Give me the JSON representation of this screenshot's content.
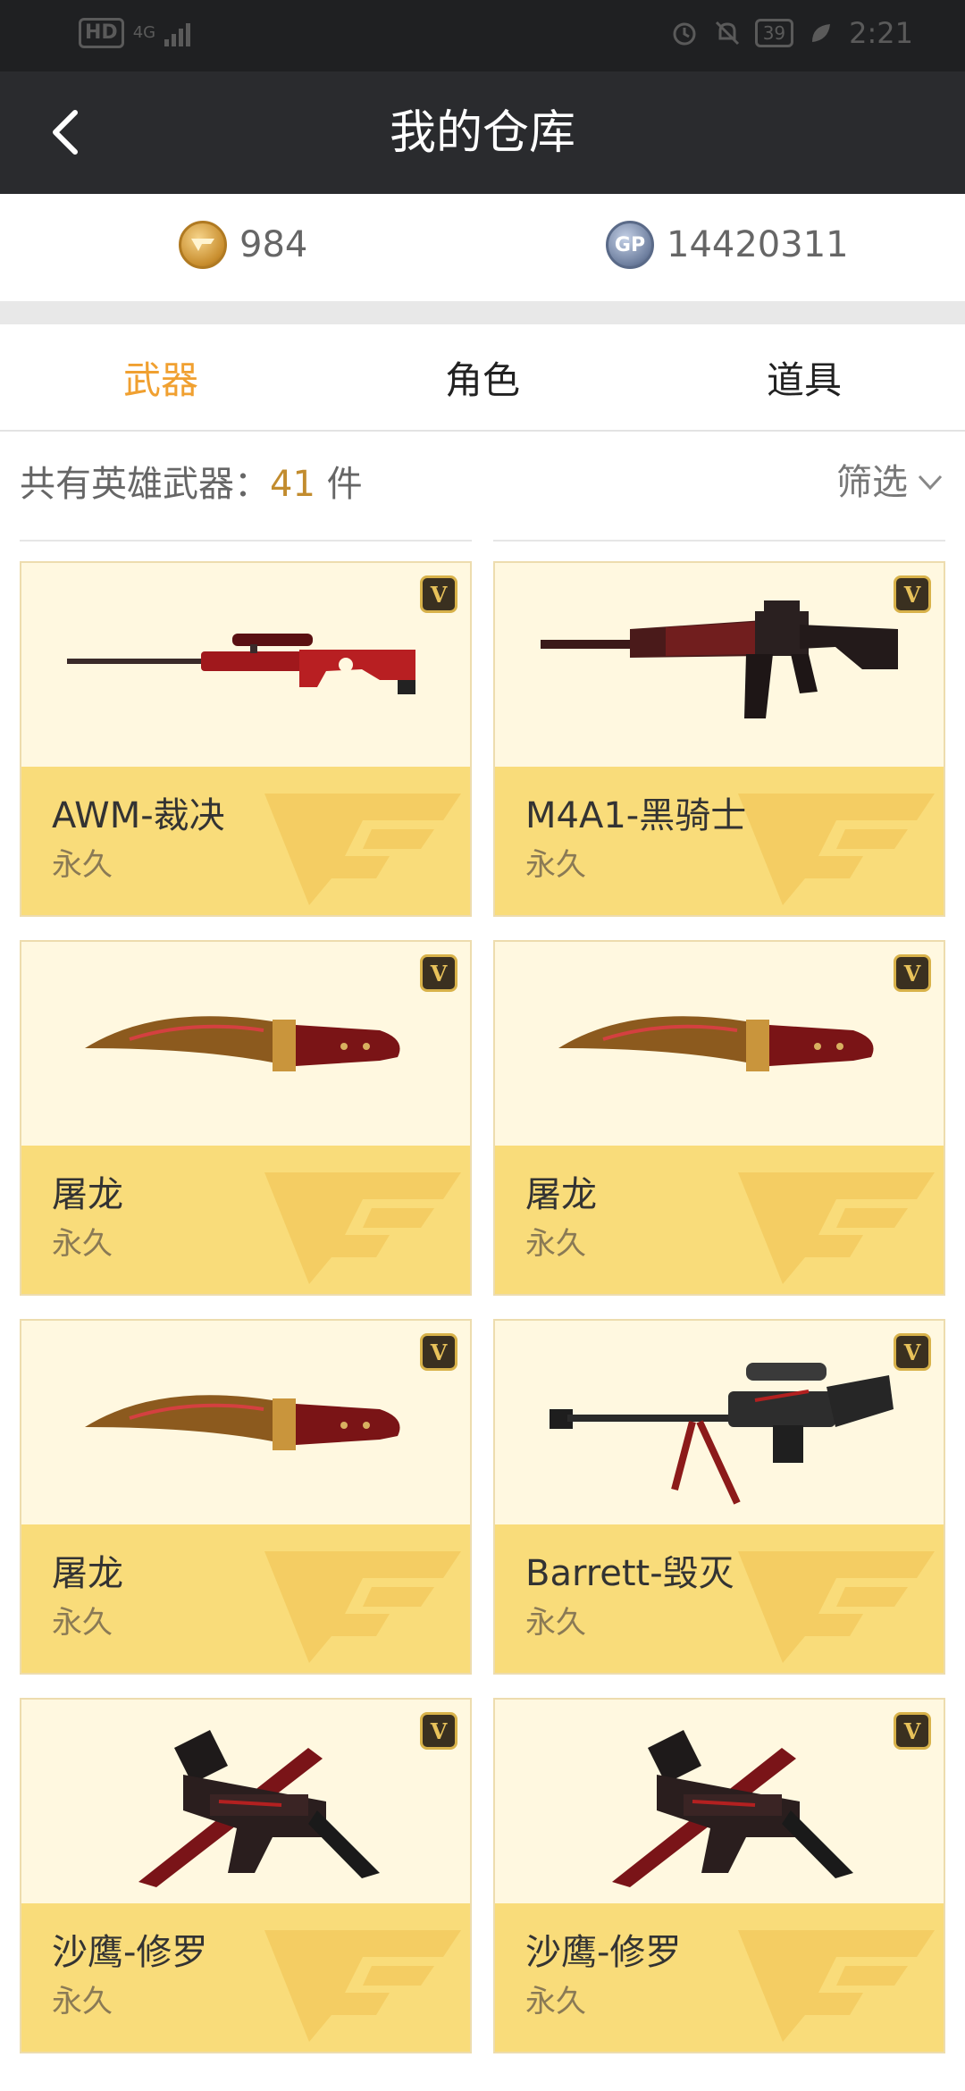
{
  "status_bar": {
    "hd": "HD",
    "network": "4G",
    "battery": "39",
    "time": "2:21",
    "icons": [
      "alarm-icon",
      "mute-icon",
      "leaf-icon"
    ]
  },
  "header": {
    "title": "我的仓库",
    "back_icon": "chevron-left-icon"
  },
  "currency": {
    "cf_points": "984",
    "gp_label": "GP",
    "gp_points": "14420311"
  },
  "tabs": [
    {
      "label": "武器",
      "active": true
    },
    {
      "label": "角色",
      "active": false
    },
    {
      "label": "道具",
      "active": false
    }
  ],
  "summary": {
    "prefix": "共有英雄武器：",
    "count": "41",
    "suffix": " 件",
    "filter_label": "筛选"
  },
  "items": [
    {
      "name": "AWM-裁决",
      "duration": "永久",
      "badge": "V",
      "weapon": "sniper-rifle"
    },
    {
      "name": "M4A1-黑骑士",
      "duration": "永久",
      "badge": "V",
      "weapon": "assault-rifle"
    },
    {
      "name": "屠龙",
      "duration": "永久",
      "badge": "V",
      "weapon": "kukri-knife"
    },
    {
      "name": "屠龙",
      "duration": "永久",
      "badge": "V",
      "weapon": "kukri-knife"
    },
    {
      "name": "屠龙",
      "duration": "永久",
      "badge": "V",
      "weapon": "kukri-knife"
    },
    {
      "name": "Barrett-毁灭",
      "duration": "永久",
      "badge": "V",
      "weapon": "heavy-sniper"
    },
    {
      "name": "沙鹰-修罗",
      "duration": "永久",
      "badge": "V",
      "weapon": "pistol-knife"
    },
    {
      "name": "沙鹰-修罗",
      "duration": "永久",
      "badge": "V",
      "weapon": "pistol-knife"
    }
  ],
  "colors": {
    "header_bg": "#2a2b2e",
    "accent": "#f0a030",
    "count": "#c28c2e",
    "card_top": "#fff8e0",
    "card_bottom": "#f9dc7a"
  }
}
